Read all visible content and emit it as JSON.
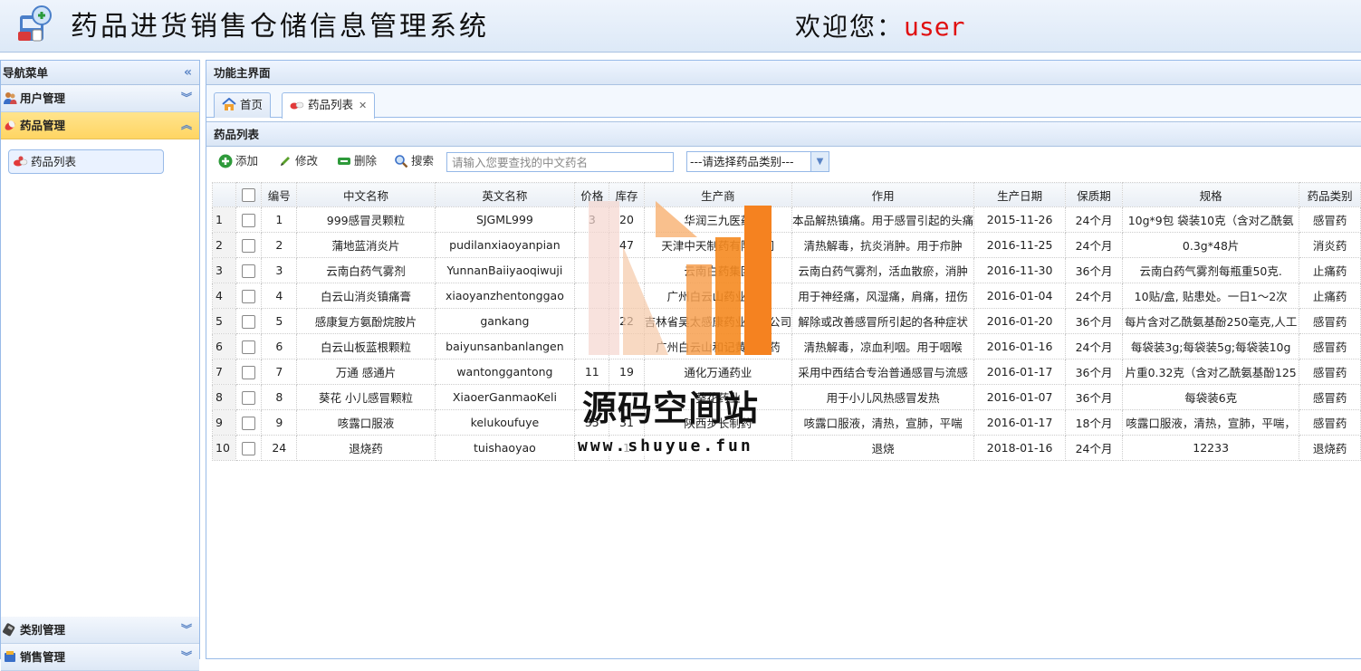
{
  "header": {
    "title": "药品进货销售仓储信息管理系统",
    "welcome_label": "欢迎您：",
    "username": "user"
  },
  "sidebar": {
    "title": "导航菜单",
    "sections": [
      {
        "label": "用户管理",
        "icon": "users-icon",
        "expanded": false
      },
      {
        "label": "药品管理",
        "icon": "pill-icon",
        "expanded": true,
        "items": [
          {
            "label": "药品列表",
            "icon": "pills-icon"
          }
        ]
      },
      {
        "label": "类别管理",
        "icon": "category-icon",
        "expanded": false
      },
      {
        "label": "销售管理",
        "icon": "sales-icon",
        "expanded": false
      }
    ]
  },
  "main": {
    "title": "功能主界面",
    "tabs": [
      {
        "label": "首页",
        "icon": "home-icon",
        "closable": false
      },
      {
        "label": "药品列表",
        "icon": "pills-icon",
        "closable": true,
        "selected": true
      }
    ],
    "grid_title": "药品列表",
    "toolbar": {
      "add": "添加",
      "edit": "修改",
      "delete": "删除",
      "search": "搜索",
      "search_placeholder": "请输入您要查找的中文药名",
      "category_select": "---请选择药品类别---"
    },
    "columns": [
      "编号",
      "中文名称",
      "英文名称",
      "价格",
      "库存",
      "生产商",
      "作用",
      "生产日期",
      "保质期",
      "规格",
      "药品类别"
    ],
    "rows": [
      [
        "1",
        "1",
        "999感冒灵颗粒",
        "SJGML999",
        "3",
        "20",
        "华润三九医药",
        "本品解热镇痛。用于感冒引起的头痛",
        "2015-11-26",
        "24个月",
        "10g*9包 袋装10克（含对乙酰氨",
        "感冒药"
      ],
      [
        "2",
        "2",
        "蒲地蓝消炎片",
        "pudilanxiaoyanpian",
        "",
        "47",
        "天津中天制药有限公司",
        "清热解毒，抗炎消肿。用于疖肿",
        "2016-11-25",
        "24个月",
        "0.3g*48片",
        "消炎药"
      ],
      [
        "3",
        "3",
        "云南白药气雾剂",
        "YunnanBaiiyaoqiwuji",
        "",
        "",
        "云南白药集团",
        "云南白药气雾剂，活血散瘀，消肿",
        "2016-11-30",
        "36个月",
        "云南白药气雾剂每瓶重50克.",
        "止痛药"
      ],
      [
        "4",
        "4",
        "白云山消炎镇痛膏",
        "xiaoyanzhentonggao",
        "",
        "",
        "广州白云山药业股份",
        "用于神经痛，风湿痛，肩痛，扭伤",
        "2016-01-04",
        "24个月",
        "10贴/盒, 贴患处。一日1～2次",
        "止痛药"
      ],
      [
        "5",
        "5",
        "感康复方氨酚烷胺片",
        "gankang",
        "",
        "22",
        "吉林省吴太感康药业有限公司",
        "解除或改善感冒所引起的各种症状",
        "2016-01-20",
        "36个月",
        "每片含对乙酰氨基酚250毫克,人工",
        "感冒药"
      ],
      [
        "6",
        "6",
        "白云山板蓝根颗粒",
        "baiyunsanbanlangen",
        "",
        "",
        "广州白云山和记黄埔中药",
        "清热解毒，凉血利咽。用于咽喉",
        "2016-01-16",
        "24个月",
        "每袋装3g;每袋装5g;每袋装10g",
        "感冒药"
      ],
      [
        "7",
        "7",
        "万通 感通片",
        "wantonggantong",
        "11",
        "19",
        "通化万通药业",
        "采用中西结合专治普通感冒与流感",
        "2016-01-17",
        "36个月",
        "片重0.32克（含对乙酰氨基酚125",
        "感冒药"
      ],
      [
        "8",
        "8",
        "葵花 小儿感冒颗粒",
        "XiaoerGanmaoKeli",
        "",
        "",
        "葵花药业",
        "用于小儿风热感冒发热",
        "2016-01-07",
        "36个月",
        "每袋装6克",
        "感冒药"
      ],
      [
        "9",
        "9",
        "咳露口服液",
        "kelukoufuye",
        "35",
        "31",
        "陕西步长制药",
        "咳露口服液，清热，宣肺，平喘",
        "2016-01-17",
        "18个月",
        "咳露口服液，清热，宣肺，平喘，",
        "感冒药"
      ],
      [
        "10",
        "24",
        "退烧药",
        "tuishaoyao",
        "",
        "1",
        "",
        "退烧",
        "2018-01-16",
        "24个月",
        "12233",
        "退烧药"
      ]
    ]
  },
  "watermark": {
    "text": "源码空间站",
    "url": "www.shuyue.fun"
  },
  "colors": {
    "accent_border": "#99bbe8",
    "active_section": "#ffd563",
    "username": "#e01010",
    "watermark_orange": "#f58220"
  }
}
